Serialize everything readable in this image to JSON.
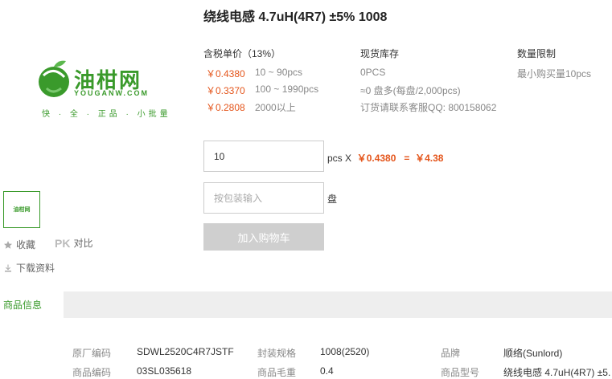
{
  "product": {
    "title": "绕线电感 4.7uH(4R7) ±5% 1008"
  },
  "logo": {
    "name": "油柑网",
    "domain": "YOUGANW.COM",
    "tagline": "快 · 全 · 正品 · 小批量"
  },
  "pricing": {
    "header": "含税单价（13%）",
    "tiers": [
      {
        "price": "￥0.4380",
        "range": "10 ~ 90pcs"
      },
      {
        "price": "￥0.3370",
        "range": "100 ~ 1990pcs"
      },
      {
        "price": "￥0.2808",
        "range": "2000以上"
      }
    ]
  },
  "stock": {
    "header": "现货库存",
    "lines": [
      "0PCS",
      "≈0 盘多(每盘/2,000pcs)",
      "订货请联系客服QQ: 800158062"
    ]
  },
  "limit": {
    "header": "数量限制",
    "text": "最小购买量10pcs"
  },
  "order": {
    "quantity_value": "10",
    "pcs_x": "pcs X",
    "unit_price": "￥0.4380",
    "equals": "=",
    "total": "￥4.38",
    "pack_placeholder": "按包装输入",
    "pack_unit": "盘",
    "cart_label": "加入购物车"
  },
  "side": {
    "thumb_text": "油柑网",
    "favorite": "收藏",
    "pk": "PK",
    "compare": "对比",
    "download": "下载资料"
  },
  "tabs": {
    "info": "商品信息"
  },
  "specs": [
    [
      {
        "label": "原厂编码",
        "value": "SDWL2520C4R7JSTF"
      },
      {
        "label": "封装规格",
        "value": "1008(2520)"
      },
      {
        "label": "品牌",
        "value": "顺络(Sunlord)"
      }
    ],
    [
      {
        "label": "商品编码",
        "value": "03SL035618"
      },
      {
        "label": "商品毛重",
        "value": "0.4"
      },
      {
        "label": "商品型号",
        "value": "绕线电感 4.7uH(4R7) ±5."
      }
    ]
  ],
  "colors": {
    "brand_green": "#3a9a2b",
    "price_orange": "#e4551b",
    "disabled_button": "#cfcfcf"
  }
}
